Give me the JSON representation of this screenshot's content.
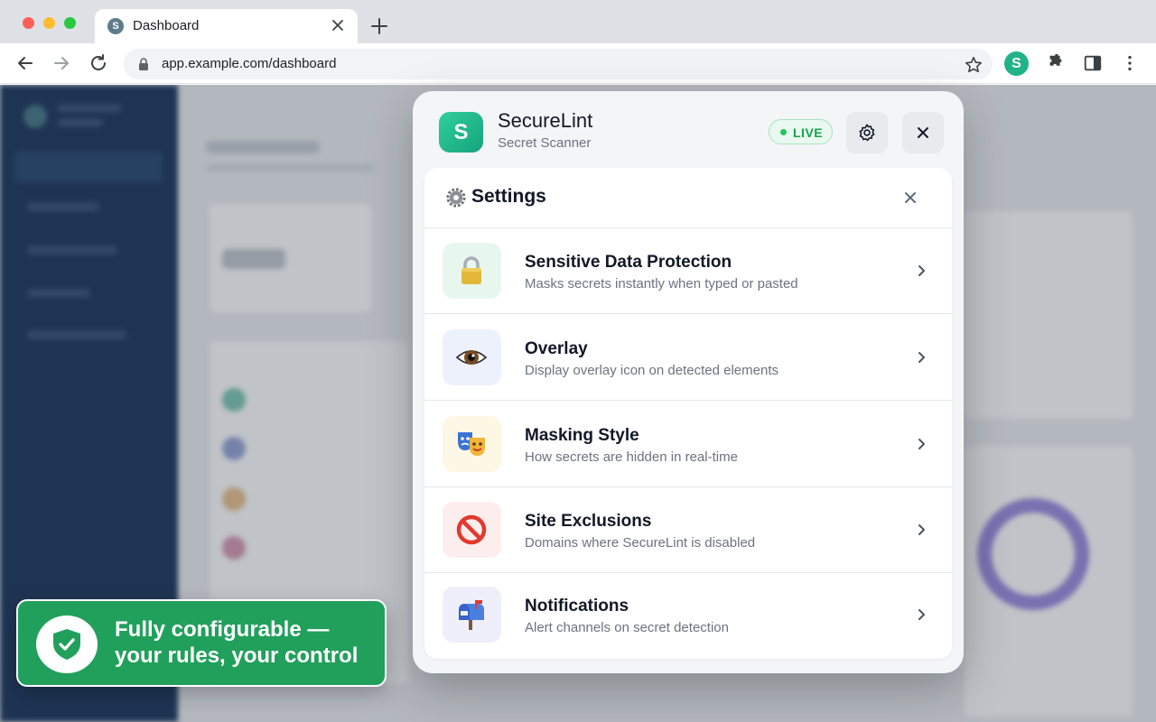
{
  "browser": {
    "tab_title": "Dashboard",
    "tab_favicon_letter": "S",
    "url": "app.example.com/dashboard",
    "extension_letter": "S"
  },
  "popup": {
    "logo_letter": "S",
    "app_name": "SecureLint",
    "app_subtitle": "Secret Scanner",
    "status_badge": "LIVE",
    "settings": {
      "title": "Settings",
      "items": [
        {
          "title": "Sensitive Data Protection",
          "description": "Masks secrets instantly when typed or pasted",
          "icon": "lock-icon"
        },
        {
          "title": "Overlay",
          "description": "Display overlay icon on detected elements",
          "icon": "eye-icon"
        },
        {
          "title": "Masking Style",
          "description": "How secrets are hidden in real-time",
          "icon": "theater-masks-icon"
        },
        {
          "title": "Site Exclusions",
          "description": "Domains where SecureLint is disabled",
          "icon": "prohibited-icon"
        },
        {
          "title": "Notifications",
          "description": "Alert channels on secret detection",
          "icon": "mailbox-icon"
        }
      ]
    }
  },
  "callout": {
    "text": "Fully configurable — your rules, your control",
    "icon": "shield-check-icon"
  },
  "colors": {
    "brand": "#1fb387",
    "callout": "#21a05c",
    "live": "#16a34a"
  }
}
